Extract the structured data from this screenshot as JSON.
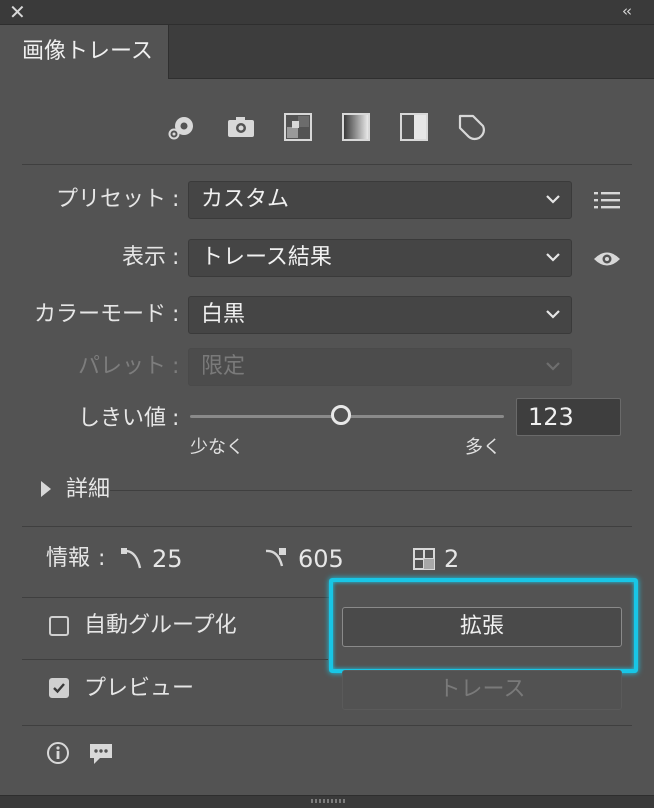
{
  "window": {
    "close_glyph": "✕",
    "collapse_glyph": "‹‹"
  },
  "tab": {
    "title": "画像トレース"
  },
  "preset_icons": [
    "auto-color-icon",
    "high-color-photo-icon",
    "low-color-icon",
    "grayscale-icon",
    "black-and-white-icon",
    "outline-icon"
  ],
  "preset": {
    "label": "プリセット",
    "colon": ":",
    "value": "カスタム",
    "menu_icon": "list-icon"
  },
  "view": {
    "label": "表示",
    "colon": ":",
    "value": "トレース結果",
    "toggle_icon": "eye-icon"
  },
  "mode": {
    "label": "カラーモード",
    "colon": ":",
    "value": "白黒"
  },
  "palette": {
    "label": "パレット",
    "colon": ":",
    "value": "限定"
  },
  "threshold": {
    "label": "しきい値",
    "colon": ":",
    "value": "123",
    "slider_fraction": 0.48,
    "min_label": "少なく",
    "max_label": "多く"
  },
  "advanced": {
    "label": "詳細"
  },
  "info": {
    "label": "情報",
    "colon": ":",
    "paths": "25",
    "anchors": "605",
    "colors": "2"
  },
  "auto_group": {
    "label": "自動グループ化",
    "checked": false
  },
  "preview": {
    "label": "プレビュー",
    "checked": true
  },
  "buttons": {
    "expand": "拡張",
    "trace": "トレース"
  },
  "colors": {
    "highlight": "#18c6e6",
    "panel_bg": "#535353"
  }
}
